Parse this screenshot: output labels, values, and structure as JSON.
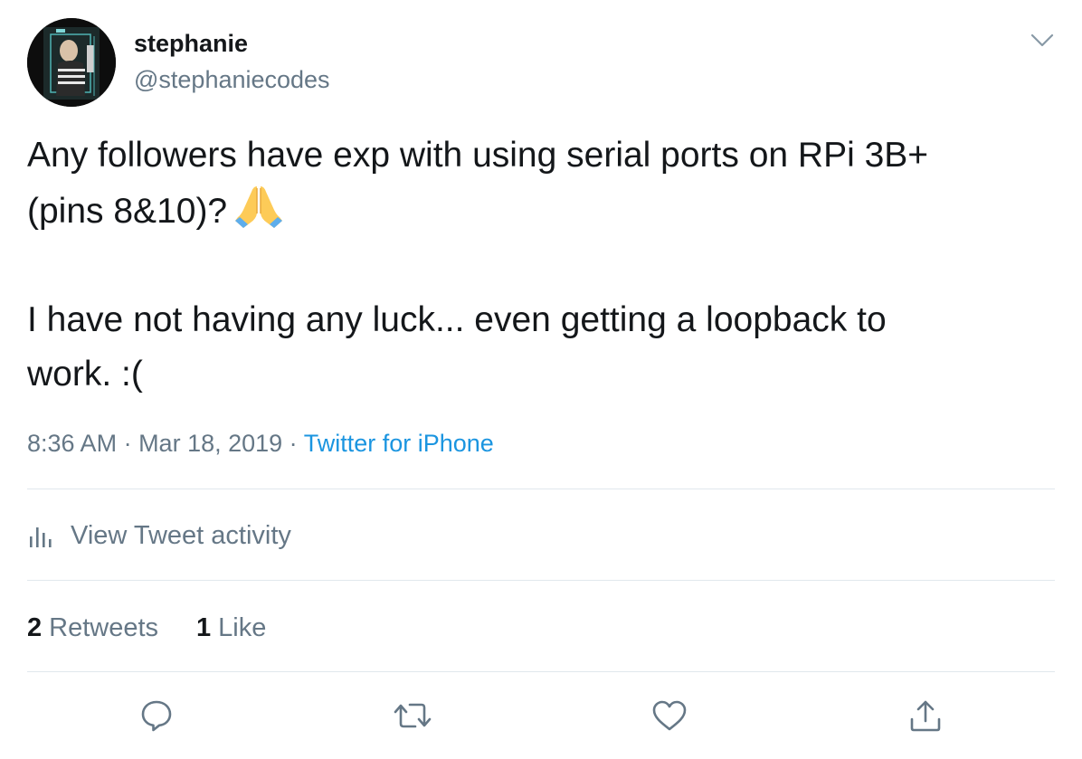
{
  "author": {
    "display_name": "stephanie",
    "handle": "@stephaniecodes"
  },
  "tweet": {
    "line1": "Any followers have exp with using serial ports on RPi 3B+",
    "line2": "(pins 8&10)?",
    "line3": "I have not having any luck... even getting a loopback to",
    "line4": "work. :(",
    "emoji": "folded-hands"
  },
  "meta": {
    "time": "8:36 AM",
    "separator": " · ",
    "date": "Mar 18, 2019",
    "source": "Twitter for iPhone"
  },
  "activity": {
    "label": "View Tweet activity"
  },
  "stats": {
    "retweets_count": "2",
    "retweets_label": "Retweets",
    "likes_count": "1",
    "likes_label": "Like"
  },
  "actions": [
    "reply-icon",
    "retweet-icon",
    "like-icon",
    "share-icon"
  ],
  "colors": {
    "text": "#14171a",
    "secondary": "#657786",
    "link": "#1b95e0",
    "divider": "#e1e8ed"
  }
}
